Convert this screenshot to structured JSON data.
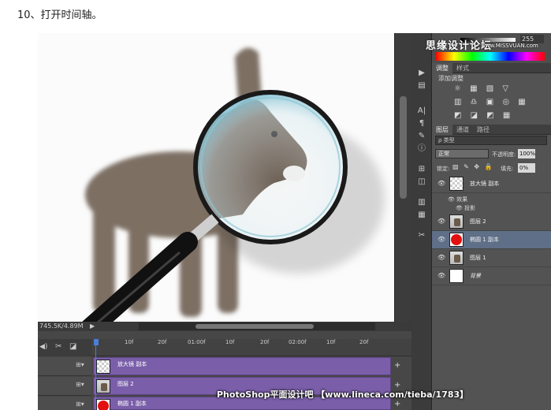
{
  "heading": "10、打开时间轴。",
  "statusbar": {
    "doc_size": "745.5K/4.89M",
    "arrow": "▶"
  },
  "color_panel": {
    "value": "255",
    "watermark_name": "思缘设计论坛",
    "watermark_url": "www.MISSVUAN.com"
  },
  "adjust_tabs": [
    "调整",
    "样式"
  ],
  "adjust_label": "添加调整",
  "adjust_rows": [
    "☼ ▦ ▧ ▽",
    "▥ ♎ ▣ ◎ ▦",
    "◩ ◪ ◩ ▦"
  ],
  "layers_tabs": [
    "图层",
    "通道",
    "路径"
  ],
  "layers": {
    "filter": "ρ 类型",
    "blend_mode": "正常",
    "opacity_label": "不透明度:",
    "opacity_value": "100%",
    "lock_label": "锁定:",
    "lock_icons": "▨ ✎ ✥ 🔒",
    "fill_label": "填充:",
    "fill_value": "0%",
    "items": [
      {
        "name": "放大镜 副本",
        "thumb": "checker",
        "selected": false
      },
      {
        "name": "图层 2",
        "thumb": "donkey",
        "selected": false
      },
      {
        "name": "椭圆 1 副本",
        "thumb": "red",
        "selected": true
      },
      {
        "name": "图层 1",
        "thumb": "donkey",
        "selected": false
      },
      {
        "name": "背景",
        "thumb": "white",
        "selected": false
      }
    ],
    "effects_label": "效果",
    "shadow_label": "投影"
  },
  "timeline": {
    "ticks": [
      "10f",
      "20f",
      "01:00f",
      "10f",
      "20f",
      "02:00f",
      "10f",
      "20f"
    ],
    "tracks": [
      {
        "name": "放大镜 副本",
        "thumb": "checker"
      },
      {
        "name": "图层 2",
        "thumb": "donkey"
      },
      {
        "name": "椭圆 1 副本",
        "thumb": "red"
      }
    ]
  },
  "watermark_bottom": "PhotoShop平面设计吧 【www.lineca.com/tieba/1783】"
}
